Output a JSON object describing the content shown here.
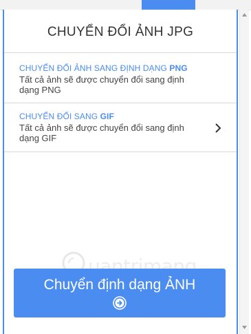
{
  "panel": {
    "title": "CHUYỂN ĐỔI ẢNH JPG",
    "options": [
      {
        "title_prefix": "CHUYỂN ĐỔI ẢNH SANG ĐỊNH DẠNG ",
        "title_format": "PNG",
        "description": "Tất cả ảnh sẽ được chuyển đổi sang định dạng PNG",
        "has_chevron": false
      },
      {
        "title_prefix": "CHUYỂN ĐỔI SANG ",
        "title_format": "GIF",
        "description": "Tất cả ảnh sẽ được chuyển đổi sang định dạng GIF",
        "has_chevron": true,
        "icon": "chevron-right-icon"
      }
    ]
  },
  "convert_button": {
    "label": "Chuyển định dạng ẢNH",
    "icon": "arrow-right-circle-icon"
  },
  "watermark": {
    "text": "uantrimang",
    "icon": "lightbulb-logo"
  },
  "colors": {
    "accent": "#4a8cf0",
    "text_dark": "#333333",
    "text_body": "#444444",
    "divider": "#d8d8d8"
  }
}
